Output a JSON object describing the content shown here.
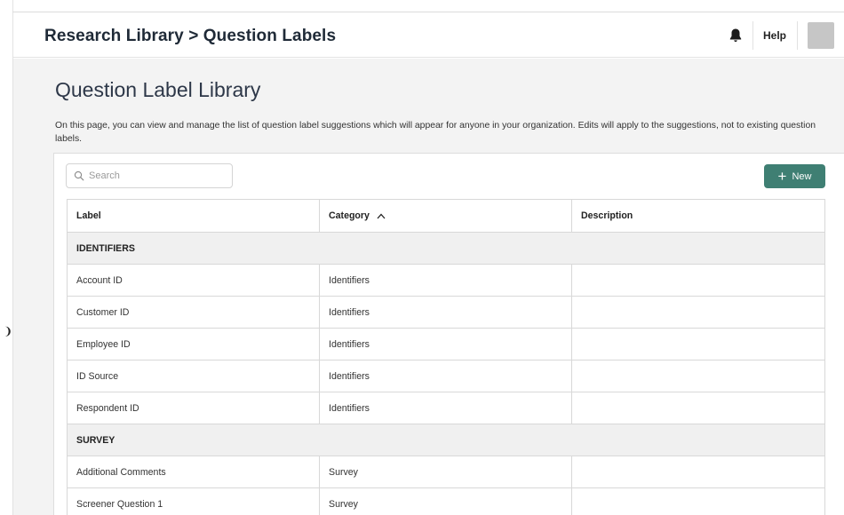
{
  "header": {
    "breadcrumb": "Research Library > Question Labels",
    "help_label": "Help"
  },
  "page": {
    "title": "Question Label Library",
    "description": "On this page, you can view and manage the list of question label suggestions which will appear for anyone in your organization. Edits will apply to the suggestions, not to existing question labels."
  },
  "toolbar": {
    "search_placeholder": "Search",
    "new_label": "New"
  },
  "table": {
    "columns": [
      "Label",
      "Category",
      "Description"
    ],
    "sort": {
      "column": "Category",
      "direction": "ascending"
    },
    "groups": [
      {
        "name": "IDENTIFIERS",
        "rows": [
          {
            "label": "Account ID",
            "category": "Identifiers",
            "description": ""
          },
          {
            "label": "Customer ID",
            "category": "Identifiers",
            "description": ""
          },
          {
            "label": "Employee ID",
            "category": "Identifiers",
            "description": ""
          },
          {
            "label": "ID Source",
            "category": "Identifiers",
            "description": ""
          },
          {
            "label": "Respondent ID",
            "category": "Identifiers",
            "description": ""
          }
        ]
      },
      {
        "name": "SURVEY",
        "rows": [
          {
            "label": "Additional Comments",
            "category": "Survey",
            "description": ""
          },
          {
            "label": "Screener Question 1",
            "category": "Survey",
            "description": ""
          }
        ]
      }
    ]
  },
  "colors": {
    "accent": "#3f7f73",
    "background": "#f3f3f3",
    "group_row": "#f0f0f0"
  },
  "icons": {
    "notifications": "bell-icon",
    "search": "search-icon",
    "new": "plus-icon",
    "sort": "chevron-up-icon"
  }
}
